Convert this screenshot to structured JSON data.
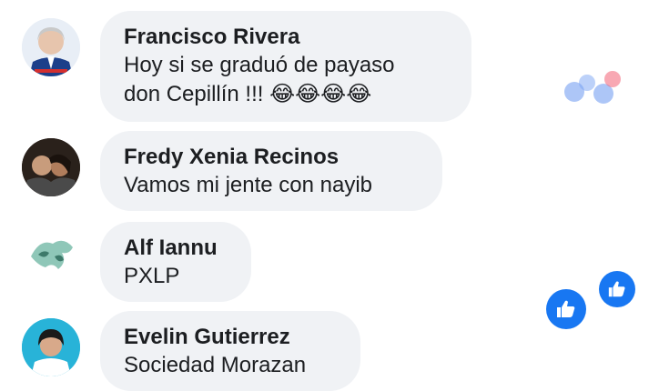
{
  "comments": [
    {
      "name": "Francisco Rivera",
      "text": "Hoy si se graduó de payaso\ndon Cepillín !!! 😂😂😂😂"
    },
    {
      "name": "Fredy Xenia Recinos",
      "text": "Vamos mi jente con nayib"
    },
    {
      "name": "Alf Iannu",
      "text": "PXLP"
    },
    {
      "name": "Evelin Gutierrez",
      "text": "Sociedad Morazan"
    }
  ],
  "icons": {
    "reaction": "like-icon"
  },
  "colors": {
    "bubble": "#f0f2f5",
    "like_blue": "#1877f2"
  }
}
